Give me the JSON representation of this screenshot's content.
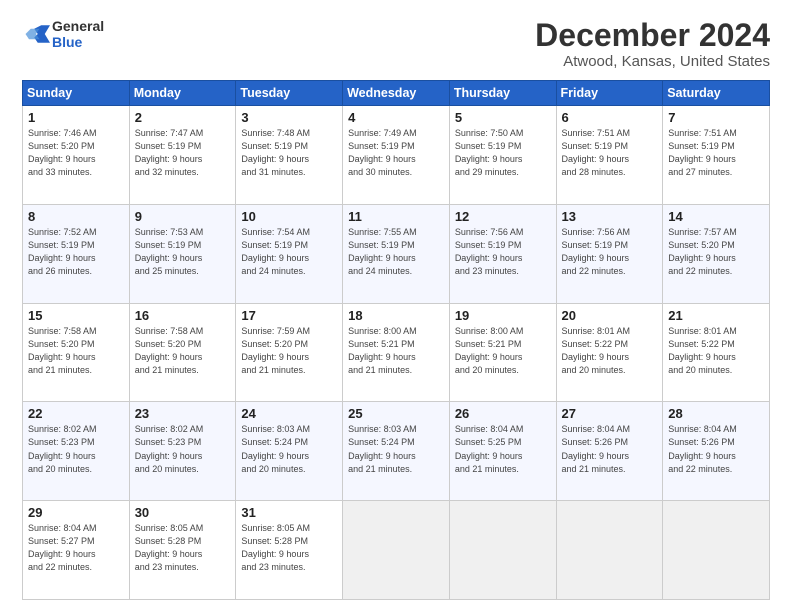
{
  "header": {
    "logo_line1": "General",
    "logo_line2": "Blue",
    "title": "December 2024",
    "subtitle": "Atwood, Kansas, United States"
  },
  "days_of_week": [
    "Sunday",
    "Monday",
    "Tuesday",
    "Wednesday",
    "Thursday",
    "Friday",
    "Saturday"
  ],
  "weeks": [
    [
      {
        "day": 1,
        "info": "Sunrise: 7:46 AM\nSunset: 5:20 PM\nDaylight: 9 hours\nand 33 minutes."
      },
      {
        "day": 2,
        "info": "Sunrise: 7:47 AM\nSunset: 5:19 PM\nDaylight: 9 hours\nand 32 minutes."
      },
      {
        "day": 3,
        "info": "Sunrise: 7:48 AM\nSunset: 5:19 PM\nDaylight: 9 hours\nand 31 minutes."
      },
      {
        "day": 4,
        "info": "Sunrise: 7:49 AM\nSunset: 5:19 PM\nDaylight: 9 hours\nand 30 minutes."
      },
      {
        "day": 5,
        "info": "Sunrise: 7:50 AM\nSunset: 5:19 PM\nDaylight: 9 hours\nand 29 minutes."
      },
      {
        "day": 6,
        "info": "Sunrise: 7:51 AM\nSunset: 5:19 PM\nDaylight: 9 hours\nand 28 minutes."
      },
      {
        "day": 7,
        "info": "Sunrise: 7:51 AM\nSunset: 5:19 PM\nDaylight: 9 hours\nand 27 minutes."
      }
    ],
    [
      {
        "day": 8,
        "info": "Sunrise: 7:52 AM\nSunset: 5:19 PM\nDaylight: 9 hours\nand 26 minutes."
      },
      {
        "day": 9,
        "info": "Sunrise: 7:53 AM\nSunset: 5:19 PM\nDaylight: 9 hours\nand 25 minutes."
      },
      {
        "day": 10,
        "info": "Sunrise: 7:54 AM\nSunset: 5:19 PM\nDaylight: 9 hours\nand 24 minutes."
      },
      {
        "day": 11,
        "info": "Sunrise: 7:55 AM\nSunset: 5:19 PM\nDaylight: 9 hours\nand 24 minutes."
      },
      {
        "day": 12,
        "info": "Sunrise: 7:56 AM\nSunset: 5:19 PM\nDaylight: 9 hours\nand 23 minutes."
      },
      {
        "day": 13,
        "info": "Sunrise: 7:56 AM\nSunset: 5:19 PM\nDaylight: 9 hours\nand 22 minutes."
      },
      {
        "day": 14,
        "info": "Sunrise: 7:57 AM\nSunset: 5:20 PM\nDaylight: 9 hours\nand 22 minutes."
      }
    ],
    [
      {
        "day": 15,
        "info": "Sunrise: 7:58 AM\nSunset: 5:20 PM\nDaylight: 9 hours\nand 21 minutes."
      },
      {
        "day": 16,
        "info": "Sunrise: 7:58 AM\nSunset: 5:20 PM\nDaylight: 9 hours\nand 21 minutes."
      },
      {
        "day": 17,
        "info": "Sunrise: 7:59 AM\nSunset: 5:20 PM\nDaylight: 9 hours\nand 21 minutes."
      },
      {
        "day": 18,
        "info": "Sunrise: 8:00 AM\nSunset: 5:21 PM\nDaylight: 9 hours\nand 21 minutes."
      },
      {
        "day": 19,
        "info": "Sunrise: 8:00 AM\nSunset: 5:21 PM\nDaylight: 9 hours\nand 20 minutes."
      },
      {
        "day": 20,
        "info": "Sunrise: 8:01 AM\nSunset: 5:22 PM\nDaylight: 9 hours\nand 20 minutes."
      },
      {
        "day": 21,
        "info": "Sunrise: 8:01 AM\nSunset: 5:22 PM\nDaylight: 9 hours\nand 20 minutes."
      }
    ],
    [
      {
        "day": 22,
        "info": "Sunrise: 8:02 AM\nSunset: 5:23 PM\nDaylight: 9 hours\nand 20 minutes."
      },
      {
        "day": 23,
        "info": "Sunrise: 8:02 AM\nSunset: 5:23 PM\nDaylight: 9 hours\nand 20 minutes."
      },
      {
        "day": 24,
        "info": "Sunrise: 8:03 AM\nSunset: 5:24 PM\nDaylight: 9 hours\nand 20 minutes."
      },
      {
        "day": 25,
        "info": "Sunrise: 8:03 AM\nSunset: 5:24 PM\nDaylight: 9 hours\nand 21 minutes."
      },
      {
        "day": 26,
        "info": "Sunrise: 8:04 AM\nSunset: 5:25 PM\nDaylight: 9 hours\nand 21 minutes."
      },
      {
        "day": 27,
        "info": "Sunrise: 8:04 AM\nSunset: 5:26 PM\nDaylight: 9 hours\nand 21 minutes."
      },
      {
        "day": 28,
        "info": "Sunrise: 8:04 AM\nSunset: 5:26 PM\nDaylight: 9 hours\nand 22 minutes."
      }
    ],
    [
      {
        "day": 29,
        "info": "Sunrise: 8:04 AM\nSunset: 5:27 PM\nDaylight: 9 hours\nand 22 minutes."
      },
      {
        "day": 30,
        "info": "Sunrise: 8:05 AM\nSunset: 5:28 PM\nDaylight: 9 hours\nand 23 minutes."
      },
      {
        "day": 31,
        "info": "Sunrise: 8:05 AM\nSunset: 5:28 PM\nDaylight: 9 hours\nand 23 minutes."
      },
      null,
      null,
      null,
      null
    ]
  ]
}
